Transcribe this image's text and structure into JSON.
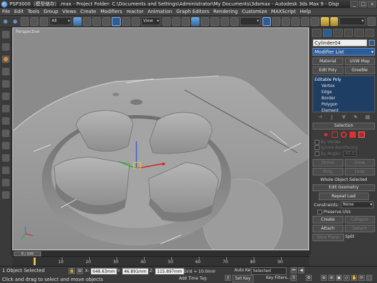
{
  "window": {
    "title": "PSP3000（模型缩存）.max  - Project Folder: C:\\Documents and Settings\\Administrator\\My Documents\\3dsmax  - Autodesk 3ds Max 9  - Disp",
    "buttons": [
      "_",
      "□",
      "×"
    ]
  },
  "menu": [
    "File",
    "Edit",
    "Tools",
    "Group",
    "Views",
    "Create",
    "Modifiers",
    "reactor",
    "Animation",
    "Graph Editors",
    "Rendering",
    "Customize",
    "MAXScript",
    "Help"
  ],
  "toolbar": {
    "selection_filter": "All",
    "ref_coord": "View",
    "named_selection": ""
  },
  "viewport": {
    "label": "Perspective"
  },
  "command_panel": {
    "object_name": "Cylinder04",
    "object_color": "#2c5a8e",
    "modifier_list": "Modifier List",
    "buttons_row1": [
      "Material",
      "UVW Map"
    ],
    "buttons_row2": [
      "Edit Poly",
      "Greeble"
    ],
    "stack": {
      "top": "Editable Poly",
      "items": [
        "Vertex",
        "Edge",
        "Border",
        "Polygon",
        "Element"
      ]
    },
    "stack_tools": [
      "⊣",
      "|",
      "∀",
      "✎",
      "▤"
    ],
    "selection": {
      "title": "Selection",
      "by_vertex": "By Vertex",
      "ignore_backfacing": "Ignore Backfacing",
      "by_angle": "By Angle:",
      "angle_value": "45.0",
      "shrink": "Shrink",
      "grow": "Grow",
      "ring": "Ring",
      "loop": "Loop",
      "status": "Whole Object Selected"
    },
    "edit_geometry": {
      "title": "Edit Geometry",
      "repeat_last": "Repeat Last",
      "constraints_label": "Constraints:",
      "constraints_value": "None",
      "preserve_uvs": "Preserve UVs",
      "create": "Create",
      "collapse": "Collapse",
      "attach": "Attach",
      "detach": "Detach",
      "slice_plane": "Slice Plane",
      "split": "Split"
    }
  },
  "time_slider": {
    "label": "0 / 100"
  },
  "trackbar": {
    "labels": [
      "10",
      "20",
      "30",
      "40",
      "50",
      "60",
      "70",
      "80",
      "90"
    ]
  },
  "status": {
    "selection": "1 Object Selected",
    "prompt": "Click and drag to select and move objects",
    "x_label": "X:",
    "x_value": "648.63mm",
    "y_label": "Y:",
    "y_value": "46.891mm",
    "z_label": "Z:",
    "z_value": "115.897mm",
    "grid": "Grid = 10.0mm",
    "add_time_tag": "Add Time Tag",
    "auto_key": "Auto Key",
    "set_key": "Set Key",
    "selected": "Selected",
    "key_filters": "Key Filters..."
  }
}
